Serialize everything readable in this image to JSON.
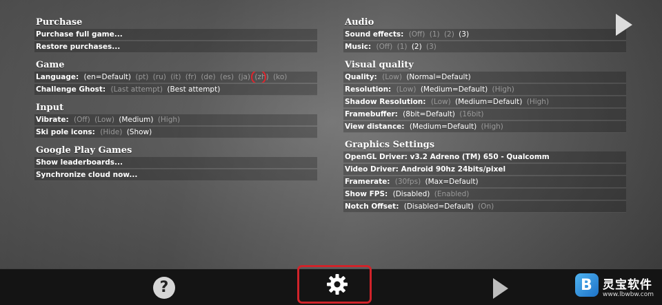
{
  "left": {
    "purchase": {
      "title": "Purchase",
      "buy_full": "Purchase full game...",
      "restore": "Restore purchases..."
    },
    "game": {
      "title": "Game",
      "language_label": "Language:",
      "language_options": [
        "(en=Default)",
        "(pt)",
        "(ru)",
        "(it)",
        "(fr)",
        "(de)",
        "(es)",
        "(ja)",
        "(zh)",
        "(ko)"
      ],
      "ghost_label": "Challenge Ghost:",
      "ghost_options": [
        "(Last attempt)",
        "(Best attempt)"
      ]
    },
    "input": {
      "title": "Input",
      "vibrate_label": "Vibrate:",
      "vibrate_options": [
        "(Off)",
        "(Low)",
        "(Medium)",
        "(High)"
      ],
      "skipole_label": "Ski pole icons:",
      "skipole_options": [
        "(Hide)",
        "(Show)"
      ]
    },
    "google": {
      "title": "Google Play Games",
      "leaderboards": "Show leaderboards...",
      "sync": "Synchronize cloud now..."
    }
  },
  "right": {
    "audio": {
      "title": "Audio",
      "sfx_label": "Sound effects:",
      "sfx_options": [
        "(Off)",
        "(1)",
        "(2)",
        "(3)"
      ],
      "music_label": "Music:",
      "music_options": [
        "(Off)",
        "(1)",
        "(2)",
        "(3)"
      ]
    },
    "visual": {
      "title": "Visual quality",
      "quality_label": "Quality:",
      "quality_options": [
        "(Low)",
        "(Normal=Default)"
      ],
      "resolution_label": "Resolution:",
      "resolution_options": [
        "(Low)",
        "(Medium=Default)",
        "(High)"
      ],
      "shadow_label": "Shadow Resolution:",
      "shadow_options": [
        "(Low)",
        "(Medium=Default)",
        "(High)"
      ],
      "framebuffer_label": "Framebuffer:",
      "framebuffer_options": [
        "(8bit=Default)",
        "(16bit)"
      ],
      "viewdist_label": "View distance:",
      "viewdist_options": [
        "(Medium=Default)",
        "(High)"
      ]
    },
    "graphics": {
      "title": "Graphics Settings",
      "opengl": "OpenGL Driver: v3.2 Adreno (TM) 650 - Qualcomm",
      "video": "Video Driver: Android 90hz 24bits/pixel",
      "framerate_label": "Framerate:",
      "framerate_options": [
        "(30fps)",
        "(Max=Default)"
      ],
      "fps_label": "Show FPS:",
      "fps_options": [
        "(Disabled)",
        "(Enabled)"
      ],
      "notch_label": "Notch Offset:",
      "notch_options": [
        "(Disabled=Default)",
        "(On)"
      ]
    }
  },
  "bottom": {
    "help_glyph": "?"
  },
  "watermark": {
    "logo_glyph": "B",
    "text": "灵宝软件",
    "url": "www.lbwbw.com"
  },
  "colors": {
    "highlight_red": "#e0242c",
    "bar": "#141414"
  }
}
